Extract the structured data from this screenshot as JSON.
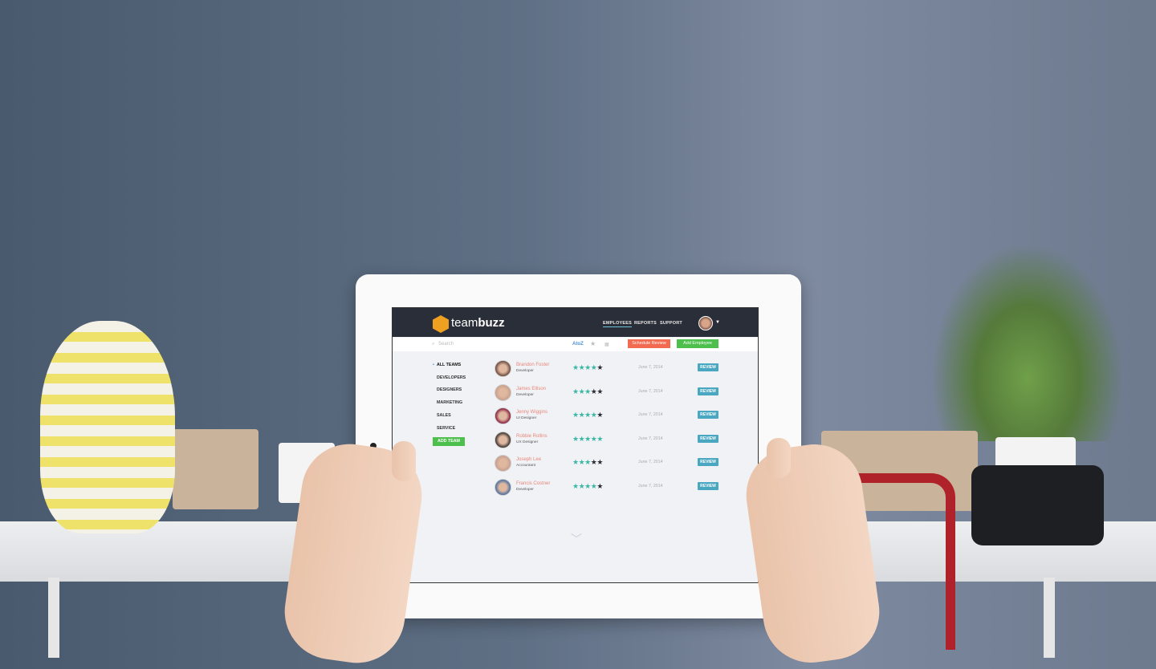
{
  "app": {
    "logo_light": "team",
    "logo_bold": "buzz",
    "nav": [
      "EMPLOYEES",
      "REPORTS",
      "SUPPORT"
    ],
    "active_nav": "EMPLOYEES"
  },
  "toolbar": {
    "search_placeholder": "Search",
    "sort_az": "AtoZ",
    "schedule_review": "Schedule Review",
    "add_employee": "Add Employee"
  },
  "sidebar": {
    "items": [
      "ALL TEAMS",
      "DEVELOPERS",
      "DESIGNERS",
      "MARKETING",
      "SALES",
      "SERVICE"
    ],
    "active": "ALL TEAMS",
    "add_team": "ADD TEAM"
  },
  "employees": [
    {
      "name": "Brandon Foster",
      "role": "Developer",
      "rating": 4,
      "date": "June 7, 2014",
      "action": "REVIEW"
    },
    {
      "name": "James Ellison",
      "role": "Developer",
      "rating": 3,
      "date": "June 7, 2014",
      "action": "REVIEW"
    },
    {
      "name": "Jenny Wiggins",
      "role": "UI Designer",
      "rating": 4,
      "date": "June 7, 2014",
      "action": "REVIEW"
    },
    {
      "name": "Robbie Rollins",
      "role": "UX Designer",
      "rating": 5,
      "date": "June 7, 2014",
      "action": "REVIEW"
    },
    {
      "name": "Joseph Lee",
      "role": "Accountant",
      "rating": 3,
      "date": "June 7, 2014",
      "action": "REVIEW"
    },
    {
      "name": "Francis Costner",
      "role": "Developer",
      "rating": 4,
      "date": "June 7, 2014",
      "action": "REVIEW"
    }
  ],
  "colors": {
    "header": "#2a2e38",
    "accent": "#f0a020",
    "star_on": "#3bb8a5",
    "star_off": "#2a2e38",
    "name": "#e8877a",
    "review": "#4aa7c1",
    "schedule": "#f26b50",
    "add": "#4cbf4c"
  }
}
